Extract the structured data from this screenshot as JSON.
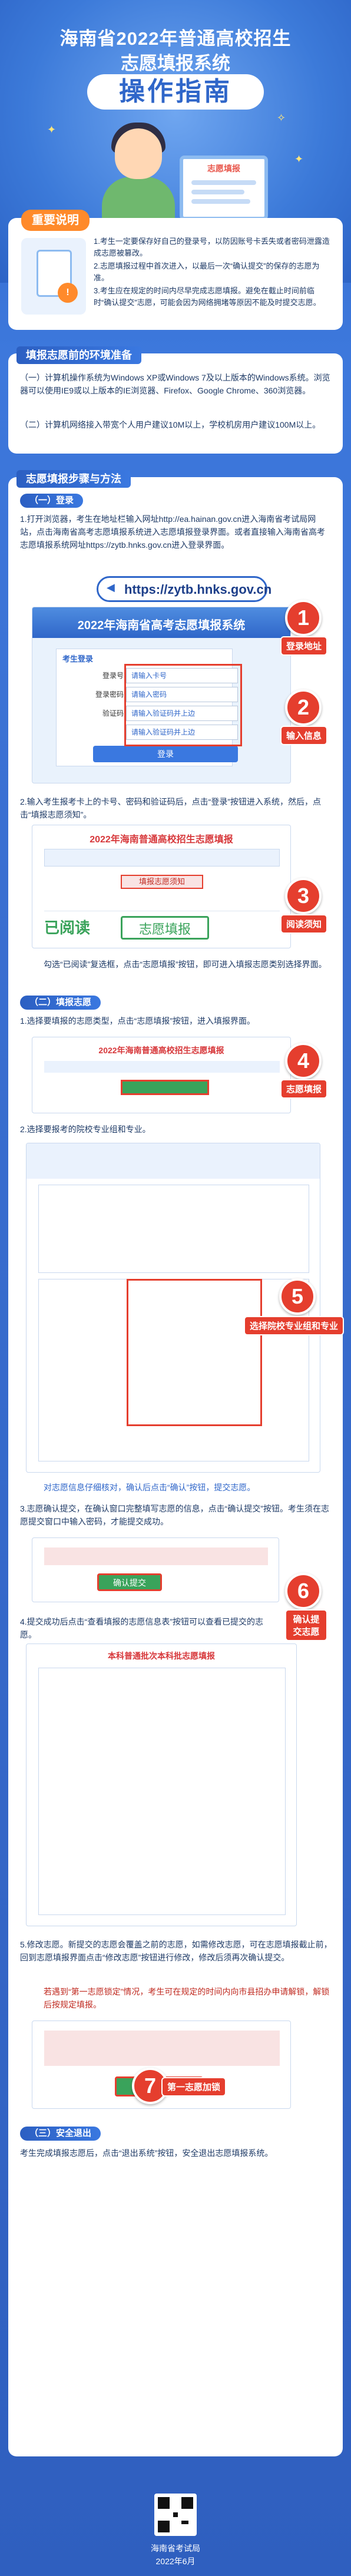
{
  "header": {
    "line1": "海南省2022年普通高校招生",
    "line2": "志愿填报系统",
    "banner": "操作指南",
    "laptop_title": "志愿填报"
  },
  "notice": {
    "tag": "重要说明",
    "items": [
      "1.考生一定要保存好自己的登录号，以防因账号卡丢失或者密码泄露造成志愿被篡改。",
      "2.志愿填报过程中首次进入，以最后一次“确认提交”的保存的志愿为准。",
      "3.考生应在规定的时间内尽早完成志愿填报。避免在截止时间前临时“确认提交”志愿，可能会因为网络拥堵等原因不能及时提交志愿。"
    ]
  },
  "env": {
    "tag": "填报志愿前的环境准备",
    "p1": "（一）计算机操作系统为Windows XP或Windows 7及以上版本的Windows系统。浏览器可以使用IE9或以上版本的IE浏览器、Firefox、Google Chrome、360浏览器。",
    "p2": "（二）计算机网络接入带宽个人用户建议10M以上，学校机房用户建议100M以上。"
  },
  "steps": {
    "tag": "志愿填报步骤与方法",
    "sub1": "（一）登录",
    "s1_text": "1.打开浏览器，考生在地址栏输入网址http://ea.hainan.gov.cn进入海南省考试局网站，点击海南省高考志愿填报系统进入志愿填报登录界面。或者直接输入海南省高考志愿填报系统网址https://zytb.hnks.gov.cn进入登录界面。",
    "url": "https://zytb.hnks.gov.cn",
    "login_title": "2022年海南省高考志愿填报系统",
    "login_label": "考生登录",
    "field_labels": [
      "登录号",
      "登录密码",
      "验证码",
      ""
    ],
    "field_values": [
      "请输入卡号",
      "请输入密码",
      "请输入验证码并上边",
      "请输入验证码并上边"
    ],
    "login_btn": "登录",
    "c1": "1",
    "c1_label": "登录地址",
    "c2": "2",
    "c2_label": "输入信息",
    "s2_text": "2.输入考生报考卡上的卡号、密码和验证码后，点击“登录”按钮进入系统，然后，点击“填报志愿须知”。",
    "notice_title": "2022年海南普通高校招生志愿填报",
    "notice_bar": "填报志愿须知",
    "read_btn": "已阅读",
    "fill_btn": "志愿填报",
    "c3": "3",
    "c3_label": "阅读须知",
    "s3_text": "勾选“已阅读”复选框，点击“志愿填报”按钮，即可进入填报志愿类别选择界面。",
    "sub2": "（二）填报志愿",
    "s4_text": "1.选择要填报的志愿类型，点击“志愿填报”按钮，进入填报界面。",
    "c4": "4",
    "c4_label": "志愿填报",
    "s5_text": "2.选择要报考的院校专业组和专业。",
    "c5": "5",
    "c5_label": "选择院校专业组和专业",
    "s6_text": "对志愿信息仔细核对，确认后点击“确认”按钮，提交志愿。",
    "s6b_text": "3.志愿确认提交，在确认窗口完整填写志愿的信息，点击“确认提交”按钮。考生须在志愿提交窗口中输入密码，才能提交成功。",
    "confirm_btn": "确认提交",
    "c6": "6",
    "c6_label": "确认提交志愿",
    "s7_text": "4.提交成功后点击“查看填报的志愿信息表”按钮可以查看已提交的志愿。",
    "table_title": "本科普通批次本科批志愿填报",
    "s8_text": "5.修改志愿。新提交的志愿会覆盖之前的志愿，如需修改志愿，可在志愿填报截止前，回到志愿填报界面点击“修改志愿”按钮进行修改，修改后须再次确认提交。",
    "warn_text": "若遇到“第一志愿锁定”情况，考生可在规定的时间内向市县招办申请解锁，解锁后按规定填报。",
    "c7": "7",
    "c7_label": "第一志愿加锁",
    "lock_btn": "第一志愿加锁",
    "sub3": "（三）安全退出",
    "s9_text": "考生完成填报志愿后，点击“退出系统”按钮，安全退出志愿填报系统。"
  },
  "footer": {
    "org": "海南省考试局",
    "date": "2022年6月"
  }
}
